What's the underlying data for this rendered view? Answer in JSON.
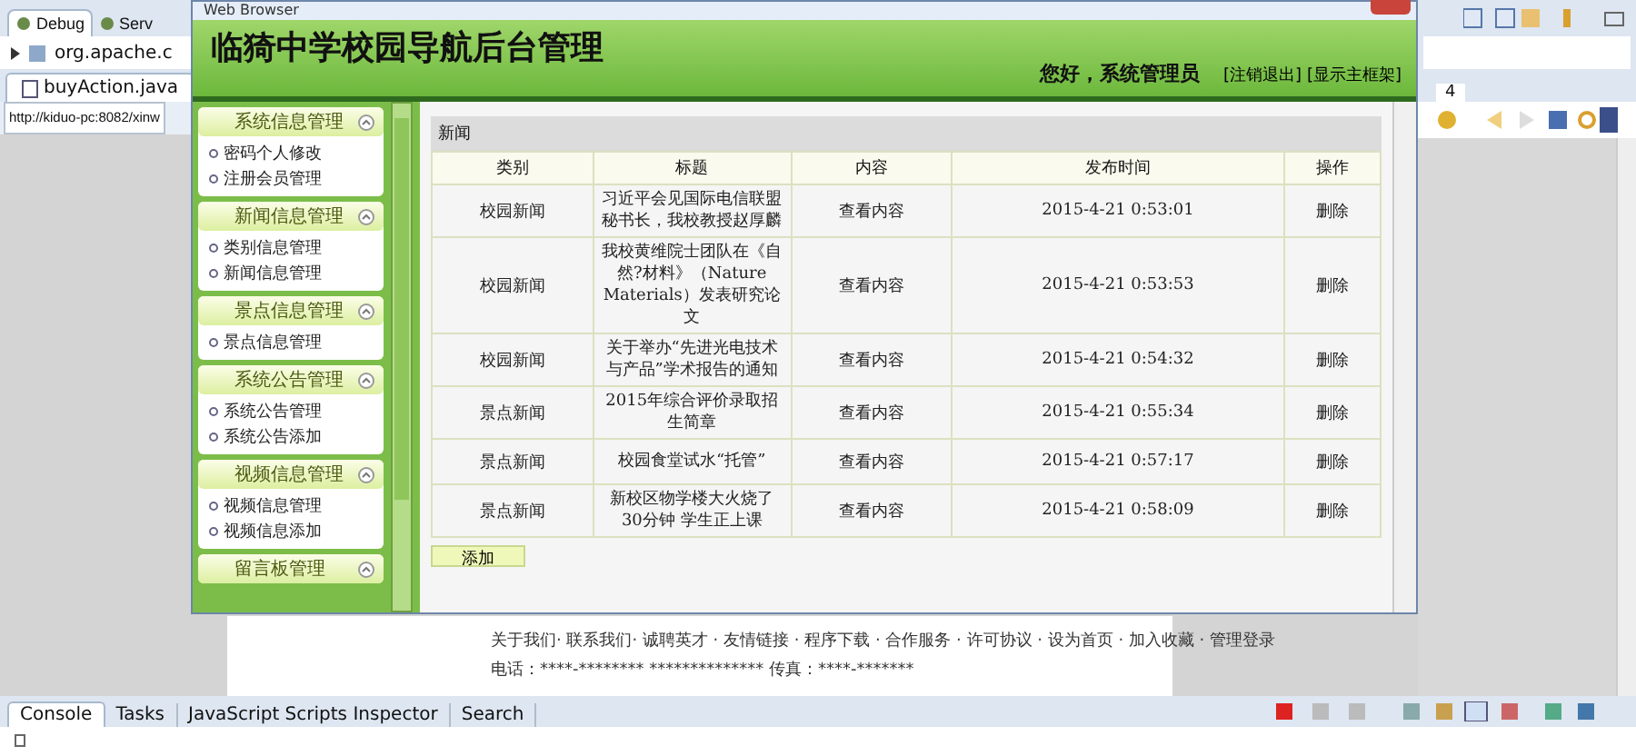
{
  "ide": {
    "views": [
      {
        "label": "Debug",
        "selected": true
      },
      {
        "label": "Serv",
        "selected": false
      }
    ],
    "breadcrumb": "org.apache.c",
    "editor_tabs": [
      {
        "label": "buyAction.java",
        "selected": true
      }
    ],
    "url": "http://kiduo-pc:8082/xinw",
    "right_panel": {
      "tab_count": "4"
    },
    "page_footer": {
      "links": "关于我们· 联系我们· 诚聘英才 · 友情链接 · 程序下载 · 合作服务 · 许可协议 · 设为首页 · 加入收藏 · 管理登录",
      "contact": "电话：****-******** ************** 传真：****-*******"
    },
    "bottom_tabs": [
      {
        "label": "Console",
        "selected": true
      },
      {
        "label": "Tasks",
        "selected": false
      },
      {
        "label": "JavaScript Scripts Inspector",
        "selected": false
      },
      {
        "label": "Search",
        "selected": false
      }
    ]
  },
  "browser": {
    "title": "Web Browser",
    "site_title": "临猗中学校园导航后台管理",
    "greeting": "您好，系统管理员",
    "header_links": [
      "[注销退出]",
      "[显示主框架]"
    ],
    "menu": [
      {
        "title": "系统信息管理",
        "items": [
          "密码个人修改",
          "注册会员管理"
        ]
      },
      {
        "title": "新闻信息管理",
        "items": [
          "类别信息管理",
          "新闻信息管理"
        ]
      },
      {
        "title": "景点信息管理",
        "items": [
          "景点信息管理"
        ]
      },
      {
        "title": "系统公告管理",
        "items": [
          "系统公告管理",
          "系统公告添加"
        ]
      },
      {
        "title": "视频信息管理",
        "items": [
          "视频信息管理",
          "视频信息添加"
        ]
      },
      {
        "title": "留言板管理"
      }
    ],
    "panel_title": "新闻",
    "table": {
      "columns": [
        "类别",
        "标题",
        "内容",
        "发布时间",
        "操作"
      ],
      "rows": [
        [
          "校园新闻",
          "习近平会见国际电信联盟秘书长，我校教授赵厚麟",
          "查看内容",
          "2015-4-21 0:53:01",
          "删除"
        ],
        [
          "校园新闻",
          "我校黄维院士团队在《自然?材料》（Nature Materials）发表研究论文",
          "查看内容",
          "2015-4-21 0:53:53",
          "删除"
        ],
        [
          "校园新闻",
          "关于举办“先进光电技术与产品”学术报告的通知",
          "查看内容",
          "2015-4-21 0:54:32",
          "删除"
        ],
        [
          "景点新闻",
          "2015年综合评价录取招生简章",
          "查看内容",
          "2015-4-21 0:55:34",
          "删除"
        ],
        [
          "景点新闻",
          "校园食堂试水“托管”",
          "查看内容",
          "2015-4-21 0:57:17",
          "删除"
        ],
        [
          "景点新闻",
          "新校区物学楼大火烧了30分钟 学生正上课",
          "查看内容",
          "2015-4-21 0:58:09",
          "删除"
        ]
      ]
    },
    "add_button": "添加"
  }
}
